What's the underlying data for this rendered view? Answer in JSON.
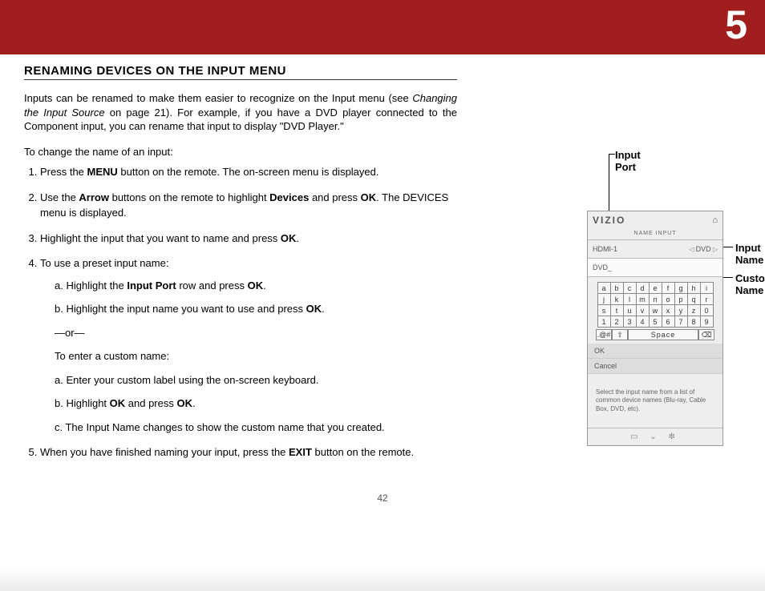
{
  "chapter": "5",
  "heading": "RENAMING DEVICES ON THE INPUT MENU",
  "intro": {
    "t1": "Inputs can be renamed to make them easier to recognize on the Input menu (see ",
    "ref": "Changing the Input Source",
    "t2": " on page 21). For example, if you have a DVD player connected to the Component input, you can rename that input to display \"DVD Player.\""
  },
  "lead": "To change the name of an input:",
  "steps": {
    "s1a": "Press the ",
    "s1b": "MENU",
    "s1c": " button on the remote. The on-screen menu is displayed.",
    "s2a": "Use the ",
    "s2b": "Arrow",
    "s2c": " buttons on the remote to highlight ",
    "s2d": "Devices",
    "s2e": " and press ",
    "s2f": "OK",
    "s2g": ". The DEVICES menu is displayed.",
    "s3a": "Highlight the input that you want to name and press ",
    "s3b": "OK",
    "s3c": ".",
    "s4": "To use a preset input name:",
    "s4aa": "a.  Highlight the ",
    "s4ab": "Input Port",
    "s4ac": " row and press ",
    "s4ad": "OK",
    "s4ae": ".",
    "s4ba": "b.  Highlight the input name you want to use and press ",
    "s4bb": "OK",
    "s4bc": ".",
    "or": "—or—",
    "custom_lead": "To enter a custom name:",
    "ca": "a.  Enter your custom label using the on-screen keyboard.",
    "cba": "b.  Highlight ",
    "cbb": "OK",
    "cbc": " and press ",
    "cbd": "OK",
    "cbe": ".",
    "cc": "c.  The Input Name changes to show the custom name that you created.",
    "s5a": "When you have finished naming your input, press the ",
    "s5b": "EXIT",
    "s5c": " button on the remote."
  },
  "page_number": "42",
  "callouts": {
    "port": "Input Port",
    "name": "Input Name",
    "custom": "Custom Name"
  },
  "screen": {
    "brand": "VIZIO",
    "title": "NAME INPUT",
    "port_value": "HDMI-1",
    "name_value": "DVD",
    "custom_value": "DVD_",
    "keys": [
      [
        "a",
        "b",
        "c",
        "d",
        "e",
        "f",
        "g",
        "h",
        "i"
      ],
      [
        "j",
        "k",
        "l",
        "m",
        "n",
        "o",
        "p",
        "q",
        "r"
      ],
      [
        "s",
        "t",
        "u",
        "v",
        "w",
        "x",
        "y",
        "z",
        "0"
      ],
      [
        "1",
        "2",
        "3",
        "4",
        "5",
        "6",
        "7",
        "8",
        "9"
      ]
    ],
    "sym": ".@#",
    "shift": "⇧",
    "space": "Space",
    "del": "⌫",
    "ok": "OK",
    "cancel": "Cancel",
    "hint": "Select the input name from a list of common device names (Blu-ray, Cable Box, DVD, etc).",
    "footer_glyphs": "▭  ⌄  ✼"
  }
}
